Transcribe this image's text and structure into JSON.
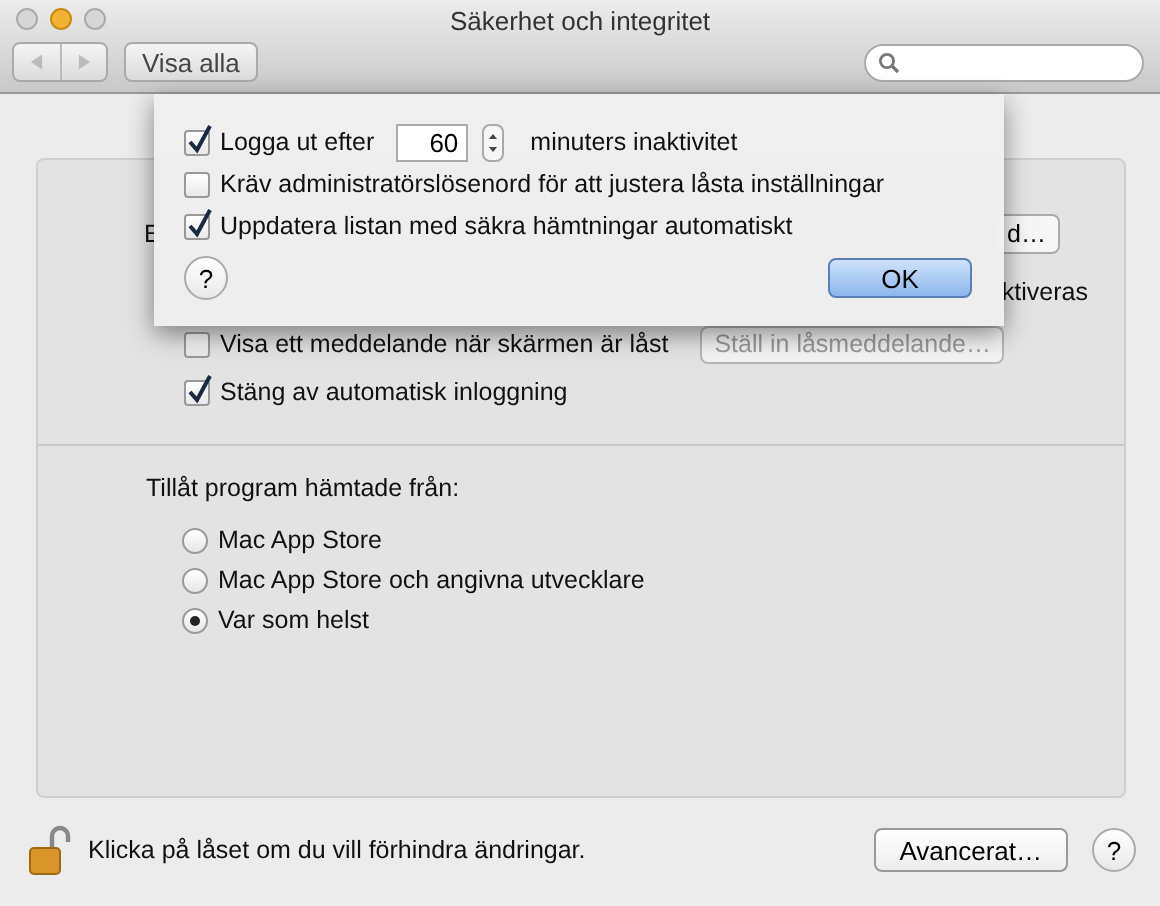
{
  "window": {
    "title": "Säkerhet och integritet",
    "show_all_button": "Visa alla"
  },
  "background_panel": {
    "row_1_text": "E",
    "row_1_button": "d…",
    "row_2_text": "ktiveras",
    "checkboxes": [
      {
        "label": "Visa ett meddelande när skärmen är låst",
        "checked": false,
        "button": "Ställ in låsmeddelande…",
        "button_disabled": true
      },
      {
        "label": "Stäng av automatisk inloggning",
        "checked": true
      }
    ],
    "allow_heading": "Tillåt program hämtade från:",
    "sources": [
      {
        "label": "Mac App Store",
        "selected": false
      },
      {
        "label": "Mac App Store och angivna utvecklare",
        "selected": false
      },
      {
        "label": "Var som helst",
        "selected": true
      }
    ]
  },
  "sheet": {
    "options": [
      {
        "kind": "stepper",
        "checked": true,
        "label": "Logga ut efter",
        "value": "60",
        "suffix": "minuters inaktivitet"
      },
      {
        "kind": "checkbox",
        "checked": false,
        "label": "Kräv administratörslösenord för att justera låsta inställningar"
      },
      {
        "kind": "checkbox",
        "checked": true,
        "label": "Uppdatera listan med säkra hämtningar automatiskt"
      }
    ],
    "help_label": "?",
    "ok_button": "OK"
  },
  "footer": {
    "lock_text": "Klicka på låset om du vill förhindra ändringar.",
    "advanced_button": "Avancerat…",
    "help_label": "?"
  }
}
